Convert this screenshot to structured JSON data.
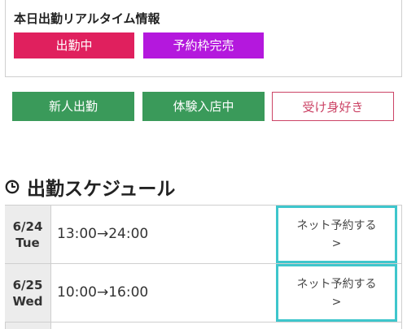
{
  "realtime": {
    "title": "本日出勤リアルタイム情報",
    "working_label": "出勤中",
    "booking_full_label": "予約枠完売"
  },
  "tags": {
    "new_label": "新人出勤",
    "trial_label": "体験入店中",
    "ukemi_label": "受け身好き"
  },
  "schedule": {
    "heading": "出勤スケジュール",
    "rows": [
      {
        "date": "6/24",
        "weekday": "Tue",
        "time": "13:00→24:00",
        "reserve_line1": "ネット予約する",
        "reserve_line2": ">"
      },
      {
        "date": "6/25",
        "weekday": "Wed",
        "time": "10:00→16:00",
        "reserve_line1": "ネット予約する",
        "reserve_line2": ">"
      }
    ]
  },
  "colors": {
    "working": "#e0205e",
    "booking_full": "#b418dd",
    "tag_green": "#3a9a5a",
    "tag_outline": "#cc4466",
    "reserve_border": "#3ec6cc"
  }
}
